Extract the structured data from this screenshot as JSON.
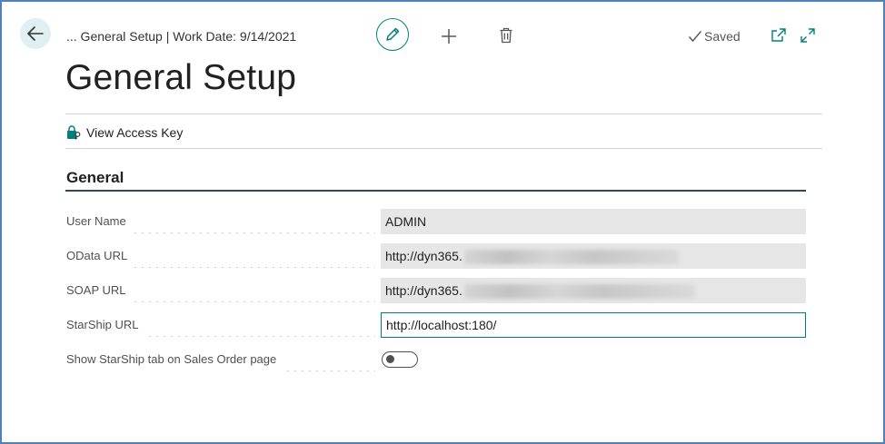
{
  "header": {
    "breadcrumb": "... General Setup | Work Date: 9/14/2021",
    "saved_label": "Saved"
  },
  "page": {
    "title": "General Setup"
  },
  "actions": {
    "view_access_key": "View Access Key"
  },
  "section": {
    "title": "General",
    "fields": [
      {
        "label": "User Name",
        "value": "ADMIN",
        "editable": false
      },
      {
        "label": "OData URL",
        "value": "http://dyn365.",
        "redacted": true,
        "editable": false
      },
      {
        "label": "SOAP URL",
        "value": "http://dyn365.",
        "redacted": true,
        "editable": false
      },
      {
        "label": "StarShip URL",
        "value": "http://localhost:180/",
        "editable": true
      },
      {
        "label": "Show StarShip tab on Sales Order page",
        "type": "toggle",
        "checked": false
      }
    ]
  },
  "colors": {
    "accent": "#00807a",
    "back_button_bg": "#dfeff2",
    "frame_border": "#4f81bd"
  },
  "icons": [
    "back-arrow-icon",
    "pencil-icon",
    "plus-icon",
    "trash-icon",
    "checkmark-icon",
    "popout-icon",
    "expand-icon",
    "key-lock-icon"
  ]
}
